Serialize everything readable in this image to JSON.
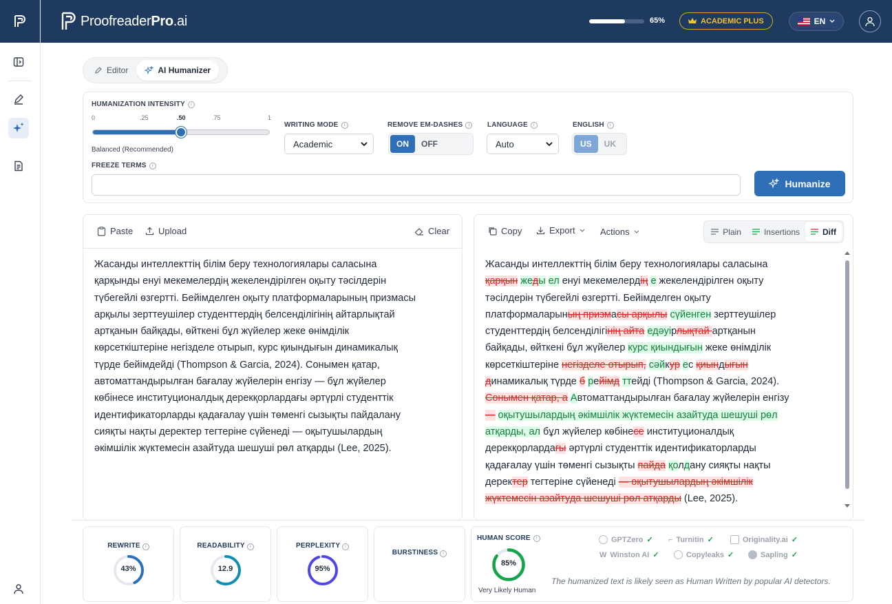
{
  "app": {
    "brand_main": "Proofreader",
    "brand_bold": "Pro",
    "brand_tld": ".ai",
    "usage_percent": "65%",
    "usage_fraction": 0.65,
    "plan": "ACADEMIC PLUS",
    "language_code": "EN"
  },
  "mode_tabs": [
    {
      "label": "Editor",
      "active": false
    },
    {
      "label": "AI Humanizer",
      "active": true
    }
  ],
  "settings": {
    "intensity_label": "HUMANIZATION INTENSITY",
    "ticks": [
      "0",
      ".25",
      ".50",
      ".75",
      "1"
    ],
    "intensity_value": 0.5,
    "intensity_caption": "Balanced (Recommended)",
    "writing_mode_label": "WRITING MODE",
    "writing_mode_value": "Academic",
    "em_dash_label": "REMOVE EM-DASHES",
    "em_on": "ON",
    "em_off": "OFF",
    "language_label": "LANGUAGE",
    "language_value": "Auto",
    "english_label": "ENGLISH",
    "english_us": "US",
    "english_uk": "UK",
    "freeze_label": "FREEZE TERMS",
    "freeze_value": "",
    "humanize_button": "Humanize"
  },
  "input_panel": {
    "paste": "Paste",
    "upload": "Upload",
    "clear": "Clear",
    "lines": [
      "Жасанды интеллекттің білім беру технологиялары саласына",
      "қарқынды енуі мекемелердің жекелендірілген оқыту тәсілдерін",
      "түбегейлі өзгертті. Бейімделген оқыту платформаларының призмасы",
      "арқылы зерттеушілер студенттердің белсенділігінің айтарлықтай",
      "артқанын байқады, өйткені бұл жүйелер жеке өнімділік",
      "көрсеткіштеріне негізделе отырып, курс қиындығын динамикалық",
      "түрде бейімдейді (Thompson & Garcia, 2024). Сонымен қатар,",
      "автоматтандырылған бағалау жүйелерін енгізу — бұл жүйелер",
      "көбінесе институционалдық дерекқорлардағы әртүрлі студенттік",
      "идентификаторларды қадағалау үшін төменгі сызықты пайдалану",
      "сияқты нақты деректер тегтеріне сүйенеді — оқытушылардың",
      "әкімшілік жүктемесін азайтуда шешуші рөл атқарды (Lee, 2025)."
    ]
  },
  "output_panel": {
    "copy": "Copy",
    "export": "Export",
    "actions": "Actions",
    "views": [
      {
        "label": "Plain",
        "active": false
      },
      {
        "label": "Insertions",
        "active": false
      },
      {
        "label": "Diff",
        "active": true
      }
    ],
    "lines": [
      [
        [
          "n",
          "Жасанды интеллекттің білім беру технологиялары саласына"
        ]
      ],
      [
        [
          "d",
          "қарқын"
        ],
        [
          "n",
          " "
        ],
        [
          "i",
          "же"
        ],
        [
          "d",
          "д"
        ],
        [
          "i",
          "ы"
        ],
        [
          "n",
          " "
        ],
        [
          "i",
          "ел"
        ],
        [
          "n",
          " енуі мекемелерд"
        ],
        [
          "d",
          "ің"
        ],
        [
          "n",
          " "
        ],
        [
          "i",
          "е"
        ],
        [
          "n",
          " жекелендірілген оқыту"
        ]
      ],
      [
        [
          "n",
          "тәсілдерін түбегейлі өзгертті. Бейімделген оқыту"
        ]
      ],
      [
        [
          "n",
          "платформаларын"
        ],
        [
          "d",
          "ың призм"
        ],
        [
          "n",
          "а"
        ],
        [
          "d",
          "сы арқылы"
        ],
        [
          "n",
          " "
        ],
        [
          "i",
          "сүйенген"
        ],
        [
          "n",
          " зерттеушілер"
        ]
      ],
      [
        [
          "n",
          "студенттердің белсенділігі"
        ],
        [
          "d",
          "нің айта"
        ],
        [
          "n",
          " "
        ],
        [
          "i",
          "едәуі"
        ],
        [
          "n",
          "р"
        ],
        [
          "d",
          "лықтай "
        ],
        [
          "n",
          " артқанын"
        ]
      ],
      [
        [
          "n",
          "байқады, өйткені бұл жүйелер "
        ],
        [
          "i",
          "курс қиындығын"
        ],
        [
          "n",
          " жеке өнімділік"
        ]
      ],
      [
        [
          "n",
          "көрсеткіштеріне "
        ],
        [
          "d",
          "негізделе отырып,"
        ],
        [
          "n",
          " "
        ],
        [
          "i",
          "сәй"
        ],
        [
          "n",
          "к"
        ],
        [
          "d",
          "ур"
        ],
        [
          "n",
          " "
        ],
        [
          "i",
          "е"
        ],
        [
          "n",
          "с "
        ],
        [
          "d",
          "қиын"
        ],
        [
          "n",
          "д"
        ],
        [
          "d",
          "ығын "
        ]
      ],
      [
        [
          "d",
          "д"
        ],
        [
          "n",
          "инамикалық түрде "
        ],
        [
          "d",
          "б"
        ],
        [
          "n",
          " "
        ],
        [
          "i",
          "р"
        ],
        [
          "n",
          "е"
        ],
        [
          "d",
          "йімд"
        ],
        [
          "n",
          " "
        ],
        [
          "i",
          "тт"
        ],
        [
          "n",
          "ейді (Thompson & Garcia, 2024)."
        ]
      ],
      [
        [
          "d",
          "Сонымен қатар, а"
        ],
        [
          "n",
          " "
        ],
        [
          "i",
          "А"
        ],
        [
          "n",
          "втоматтандырылған бағалау жүйелерін енгізу"
        ]
      ],
      [
        [
          "d",
          "—"
        ],
        [
          "n",
          " "
        ],
        [
          "i",
          "оқытушылардың әкімшілік жүктемесін азайтуда шешуші рөл"
        ]
      ],
      [
        [
          "i",
          "атқарды, ал"
        ],
        [
          "n",
          " бұл жүйелер көбіне"
        ],
        [
          "d",
          "се"
        ],
        [
          "n",
          " институционалдық"
        ]
      ],
      [
        [
          "n",
          "дерекқорларда"
        ],
        [
          "d",
          "ғы"
        ],
        [
          "n",
          " әртүрлі студенттік идентификаторларды"
        ]
      ],
      [
        [
          "n",
          "қадағалау үшін төменгі сызықты "
        ],
        [
          "d",
          "пайда"
        ],
        [
          "n",
          " "
        ],
        [
          "i",
          "қо"
        ],
        [
          "n",
          "л"
        ],
        [
          "i",
          "д"
        ],
        [
          "n",
          "ану сияқты нақты"
        ]
      ],
      [
        [
          "n",
          "дерек"
        ],
        [
          "d",
          "тер"
        ],
        [
          "n",
          " тегтеріне сүйенеді "
        ],
        [
          "d",
          "— оқытушылардың әкімшілік"
        ]
      ],
      [
        [
          "d",
          "жүктемесін азайтуда шешуші рөл атқарды"
        ],
        [
          "n",
          " (Lee, 2025)."
        ]
      ]
    ]
  },
  "metrics": {
    "rewrite": {
      "label": "REWRITE",
      "value": "43%",
      "fraction": 0.43,
      "color": "#2f6fb8"
    },
    "readability": {
      "label": "READABILITY",
      "value": "12.9",
      "fraction": 0.6,
      "color": "#0e8fb0"
    },
    "perplexity": {
      "label": "PERPLEXITY",
      "value": "95%",
      "fraction": 0.95,
      "color": "#4f46e5"
    },
    "burstiness": {
      "label": "BURSTINESS"
    },
    "human_score": {
      "label": "HUMAN SCORE",
      "value": "85%",
      "fraction": 0.85,
      "color": "#16a34a",
      "caption": "Very Likely Human"
    }
  },
  "detectors": [
    "GPTZero",
    "Turnitin",
    "Originality.ai",
    "Winston AI",
    "Copyleaks",
    "Sapling"
  ],
  "detector_note": "The humanized text is likely seen as Human Written by popular AI detectors."
}
